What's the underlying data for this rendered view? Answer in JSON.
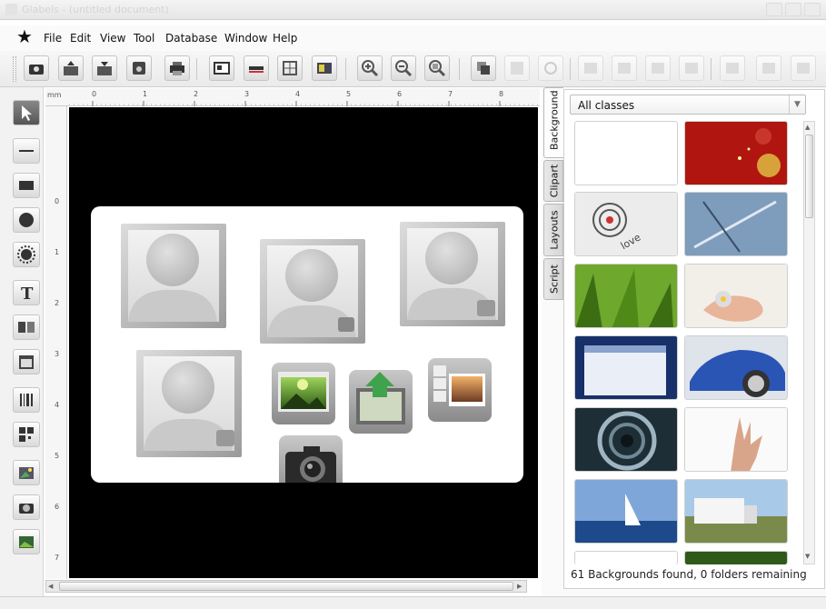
{
  "window": {
    "title": "Glabels - (untitled document)"
  },
  "menu": {
    "file": "File",
    "edit": "Edit",
    "view": "View",
    "tool": "Tool",
    "database": "Database",
    "window": "Window",
    "help": "Help"
  },
  "ruler": {
    "unit": "mm",
    "h_numbers": [
      "0",
      "1",
      "2",
      "3",
      "4",
      "5",
      "6",
      "7",
      "8"
    ],
    "v_numbers": [
      "0",
      "1",
      "2",
      "3",
      "4",
      "5",
      "6",
      "7"
    ]
  },
  "side_tabs": [
    "Background",
    "Clipart",
    "Layouts",
    "Script"
  ],
  "gallery": {
    "class_filter": "All classes",
    "status": "61 Backgrounds found, 0 folders remaining",
    "thumbs": [
      "blank",
      "red-ornaments",
      "love-target",
      "blueprint-tools",
      "green-grass",
      "hand-with-gem",
      "calendar",
      "blue-car",
      "spiral-staircase",
      "raised-hand",
      "sailboat",
      "truck-road",
      "partial-1",
      "partial-2"
    ]
  },
  "colors": {
    "canvas": "#000000",
    "card": "#ffffff",
    "accent_green": "#3fa34d"
  }
}
